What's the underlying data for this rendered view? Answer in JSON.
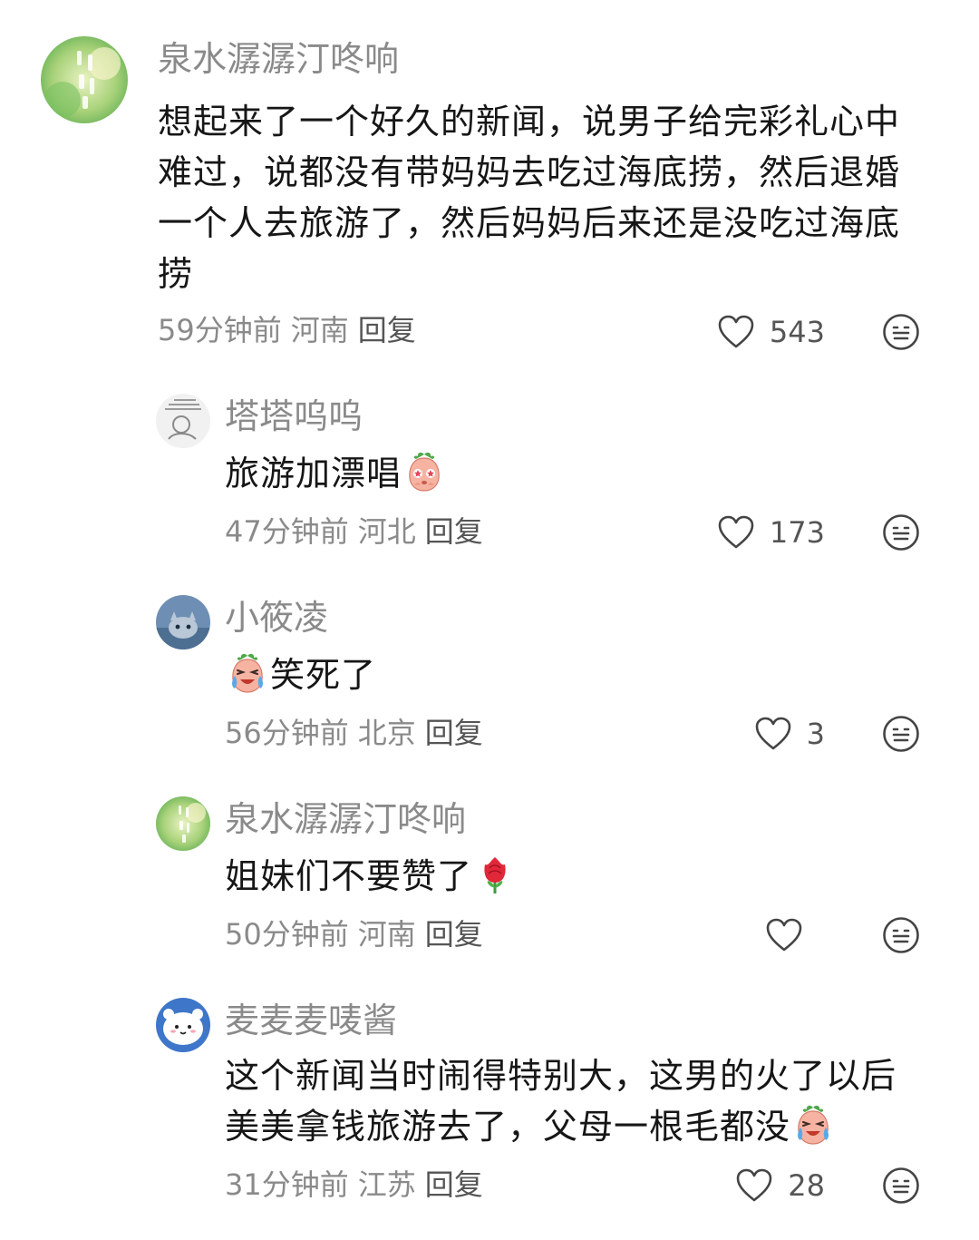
{
  "comments": [
    {
      "username": "泉水潺潺汀咚响",
      "text": "想起来了一个好久的新闻，说男子给完彩礼心中难过，说都没有带妈妈去吃过海底捞，然后退婚一个人去旅游了，然后妈妈后来还是没吃过海底捞",
      "time": "59分钟前",
      "location": "河南",
      "reply": "回复",
      "likes": "543"
    },
    {
      "username": "塔塔呜呜",
      "text": "旅游加漂唱",
      "time": "47分钟前",
      "location": "河北",
      "reply": "回复",
      "likes": "173"
    },
    {
      "username": "小筱凌",
      "text": "笑死了",
      "time": "56分钟前",
      "location": "北京",
      "reply": "回复",
      "likes": "3"
    },
    {
      "username": "泉水潺潺汀咚响",
      "text": "姐妹们不要赞了",
      "time": "50分钟前",
      "location": "河南",
      "reply": "回复",
      "likes": ""
    },
    {
      "username": "麦麦麦唛酱",
      "text": "这个新闻当时闹得特别大，这男的火了以后美美拿钱旅游去了，父母一根毛都没",
      "time": "31分钟前",
      "location": "江苏",
      "reply": "回复",
      "likes": "28"
    }
  ],
  "icons": {
    "like": "heart-outline-icon",
    "dislike": "meh-face-icon",
    "emoji_peach_starry": "peach-starry-eyes-emoji",
    "emoji_peach_crying": "peach-laugh-cry-emoji",
    "emoji_rose": "rose-emoji"
  },
  "colors": {
    "text": "#161616",
    "secondary": "#8a8a8a",
    "icon": "#444444"
  }
}
